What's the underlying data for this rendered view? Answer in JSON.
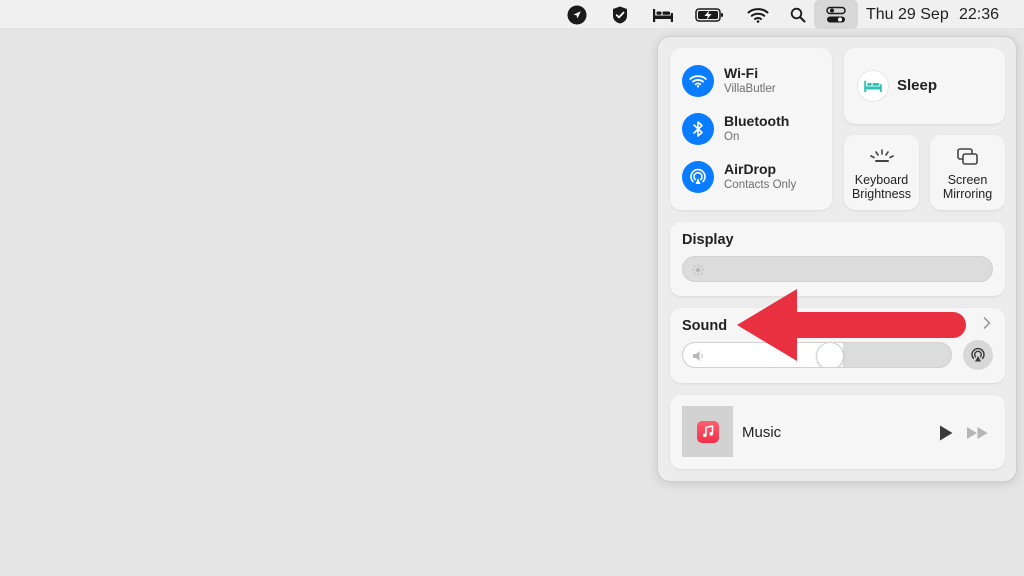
{
  "menubar": {
    "date": "Thu 29 Sep",
    "time": "22:36",
    "icons": [
      "location-arrow-icon",
      "checkmark-badge-icon",
      "bed-icon",
      "battery-charging-icon",
      "wifi-icon",
      "search-icon",
      "control-center-icon"
    ]
  },
  "control_center": {
    "network": {
      "wifi": {
        "title": "Wi-Fi",
        "subtitle": "VillaButler"
      },
      "bluetooth": {
        "title": "Bluetooth",
        "subtitle": "On"
      },
      "airdrop": {
        "title": "AirDrop",
        "subtitle": "Contacts Only"
      }
    },
    "sleep": {
      "label": "Sleep"
    },
    "keyboard_brightness": {
      "line1": "Keyboard",
      "line2": "Brightness"
    },
    "screen_mirroring": {
      "line1": "Screen",
      "line2": "Mirroring"
    },
    "display": {
      "title": "Display",
      "brightness_fraction": 0.0
    },
    "sound": {
      "title": "Sound",
      "volume_fraction": 0.55
    },
    "now_playing": {
      "title": "Music"
    }
  },
  "colors": {
    "accent_blue": "#0a7cff",
    "annotation_red": "#e83040",
    "sleep_teal": "#2ec4b6"
  }
}
